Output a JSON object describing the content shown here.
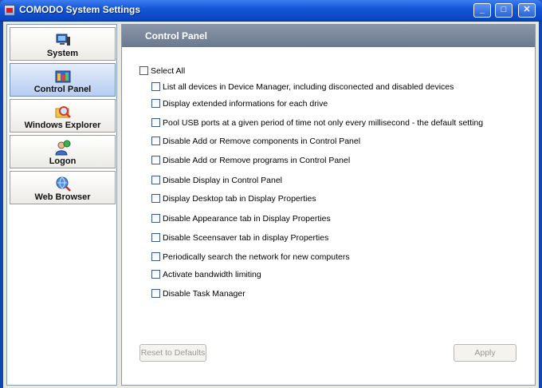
{
  "window": {
    "title": "COMODO System Settings"
  },
  "sidebar": {
    "items": [
      {
        "label": "System"
      },
      {
        "label": "Control Panel"
      },
      {
        "label": "Windows Explorer"
      },
      {
        "label": "Logon"
      },
      {
        "label": "Web Browser"
      }
    ],
    "active": "Control Panel"
  },
  "panel": {
    "title": "Control Panel",
    "select_all": "Select All",
    "options": [
      "List all devices in Device Manager, including disconected and disabled devices",
      "Display extended informations for each drive",
      "Pool USB ports at a given period of time  not only every millisecond - the default setting",
      "Disable Add or Remove components in Control Panel",
      "Disable Add or Remove  programs in Control Panel",
      "Disable Display in Control Panel",
      "Display Desktop tab  in Display Properties",
      "Disable Appearance tab in  Display Properties",
      "Disable Sceensaver tab in display Properties",
      "Periodically search the network for new computers",
      "Activate bandwidth limiting",
      "Disable Task Manager"
    ],
    "reset_label": "Reset to Defaults",
    "apply_label": "Apply"
  }
}
